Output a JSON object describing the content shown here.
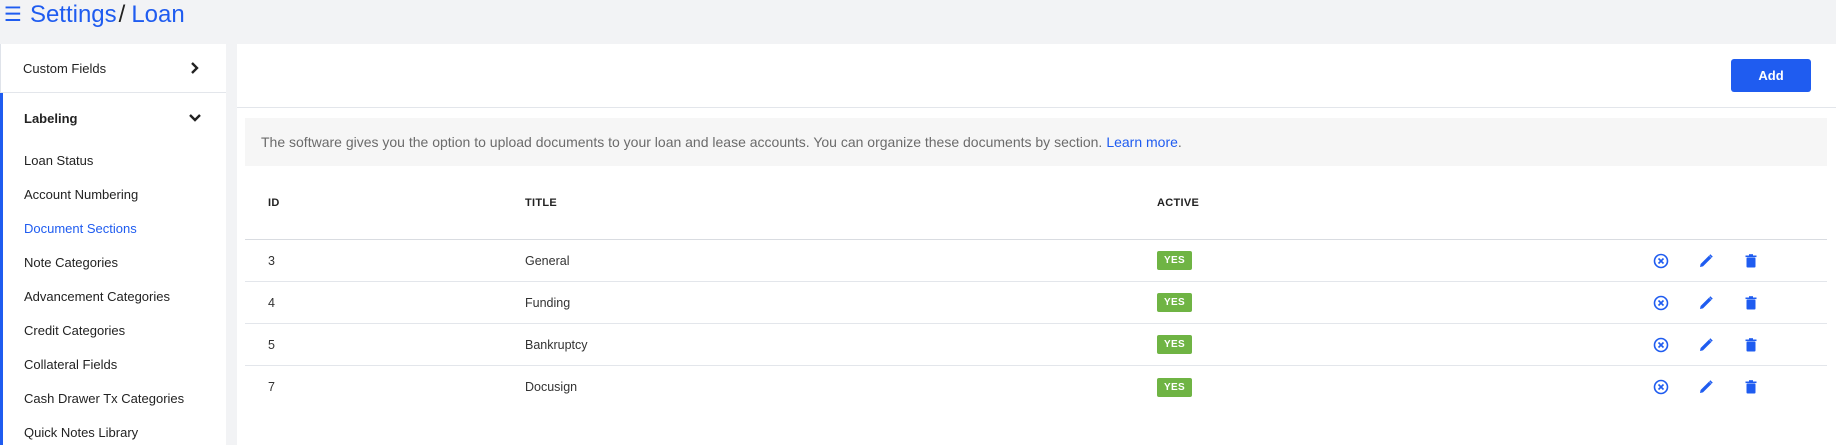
{
  "header": {
    "menu_icon": "hamburger-icon",
    "breadcrumb": [
      "Settings",
      "Loan"
    ],
    "separator": "/"
  },
  "sidebar": {
    "custom_fields": "Custom Fields",
    "labeling": "Labeling",
    "items": [
      {
        "label": "Loan Status",
        "active": false
      },
      {
        "label": "Account Numbering",
        "active": false
      },
      {
        "label": "Document Sections",
        "active": true
      },
      {
        "label": "Note Categories",
        "active": false
      },
      {
        "label": "Advancement Categories",
        "active": false
      },
      {
        "label": "Credit Categories",
        "active": false
      },
      {
        "label": "Collateral Fields",
        "active": false
      },
      {
        "label": "Cash Drawer Tx Categories",
        "active": false
      },
      {
        "label": "Quick Notes Library",
        "active": false
      }
    ]
  },
  "main": {
    "add_label": "Add",
    "info_text": "The software gives you the option to upload documents to your loan and lease accounts. You can organize these documents by section.",
    "info_link": "Learn more",
    "info_end": ".",
    "columns": [
      "ID",
      "TITLE",
      "ACTIVE"
    ],
    "rows": [
      {
        "id": "3",
        "title": "General",
        "active": "YES"
      },
      {
        "id": "4",
        "title": "Funding",
        "active": "YES"
      },
      {
        "id": "5",
        "title": "Bankruptcy",
        "active": "YES"
      },
      {
        "id": "7",
        "title": "Docusign",
        "active": "YES"
      }
    ],
    "row_actions": [
      "deactivate-icon",
      "edit-icon",
      "delete-icon"
    ]
  },
  "colors": {
    "accent": "#1f5cf0",
    "active_badge": "#6fb444"
  }
}
